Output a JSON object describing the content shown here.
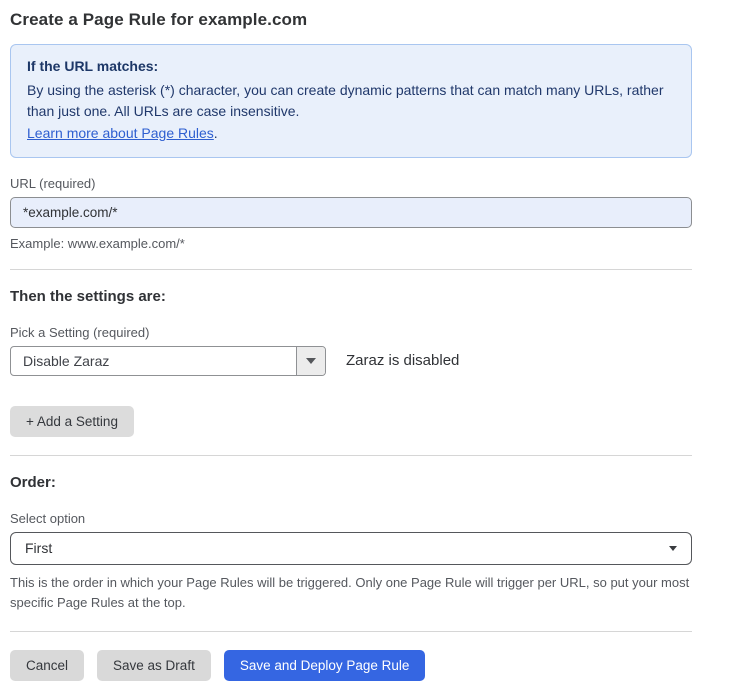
{
  "page": {
    "title": "Create a Page Rule for example.com"
  },
  "info_box": {
    "heading": "If the URL matches:",
    "body": "By using the asterisk (*) character, you can create dynamic patterns that can match many URLs, rather than just one. All URLs are case insensitive.",
    "link": "Learn more about Page Rules",
    "link_suffix": "."
  },
  "url_field": {
    "label": "URL (required)",
    "value": "*example.com/*",
    "example": "Example: www.example.com/*"
  },
  "settings_section": {
    "heading": "Then the settings are:",
    "picker_label": "Pick a Setting (required)",
    "picker_value": "Disable Zaraz",
    "status_text": "Zaraz is disabled",
    "add_button_label": "+ Add a Setting"
  },
  "order_section": {
    "heading": "Order:",
    "select_label": "Select option",
    "select_value": "First",
    "help_text": "This is the order in which your Page Rules will be triggered. Only one Page Rule will trigger per URL, so put your most specific Page Rules at the top."
  },
  "footer": {
    "cancel_label": "Cancel",
    "save_draft_label": "Save as Draft",
    "save_deploy_label": "Save and Deploy Page Rule"
  },
  "colors": {
    "accent_blue": "#3566e2",
    "info_background": "#e9f0fb",
    "info_border": "#a9c6f0",
    "info_text": "#20386b",
    "link_blue": "#2d5ed0",
    "input_background": "#e8eefb",
    "button_gray": "#d9d9d9"
  }
}
